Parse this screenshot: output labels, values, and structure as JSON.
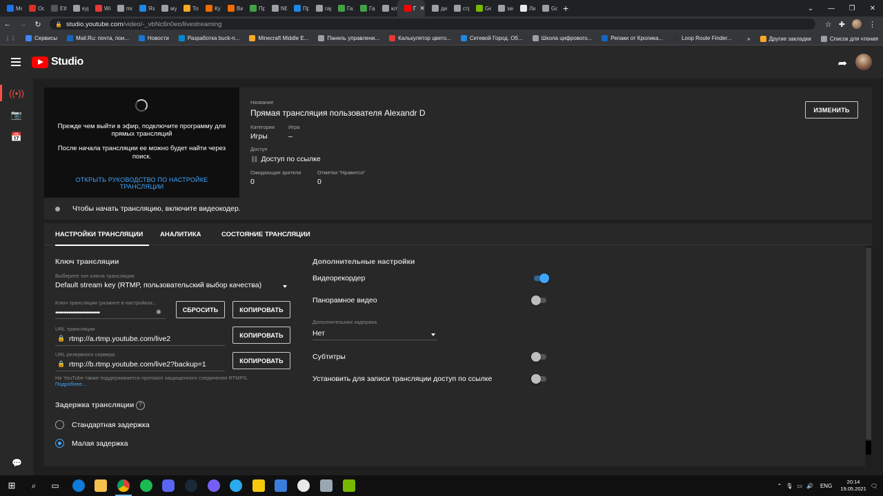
{
  "browser": {
    "tabs": [
      {
        "label": "Мес",
        "color": "#1a73e8"
      },
      {
        "label": "Офс",
        "color": "#d93025"
      },
      {
        "label": "Ethe",
        "color": "#555555"
      },
      {
        "label": "курс",
        "color": "#9aa0a6"
      },
      {
        "label": "Wio",
        "color": "#e53935"
      },
      {
        "label": "mod",
        "color": "#9aa0a6"
      },
      {
        "label": "Язык",
        "color": "#1e88e5"
      },
      {
        "label": "муст",
        "color": "#9aa0a6"
      },
      {
        "label": "Това",
        "color": "#f9a825"
      },
      {
        "label": "Купи",
        "color": "#ef6c00"
      },
      {
        "label": "Виде",
        "color": "#ef6c00"
      },
      {
        "label": "Прис",
        "color": "#43a047"
      },
      {
        "label": "NEO",
        "color": "#9aa0a6"
      },
      {
        "label": "Прос",
        "color": "#1e88e5"
      },
      {
        "label": "гара",
        "color": "#9aa0a6"
      },
      {
        "label": "Гара",
        "color": "#43a047"
      },
      {
        "label": "Гара",
        "color": "#43a047"
      },
      {
        "label": "ютуб",
        "color": "#9aa0a6"
      },
      {
        "label": "Г",
        "color": "#ff0000",
        "active": true
      },
      {
        "label": "диск",
        "color": "#9aa0a6"
      },
      {
        "label": "стри",
        "color": "#9aa0a6"
      },
      {
        "label": "Gefo",
        "color": "#76b900"
      },
      {
        "label": "забы",
        "color": "#9aa0a6"
      },
      {
        "label": "Личн",
        "color": "#e8eaed"
      },
      {
        "label": "Goo",
        "color": "#9aa0a6"
      }
    ],
    "url_host": "studio.youtube.com",
    "url_path": "/video/-_vbNc6n0eo/livestreaming",
    "bookmarks": [
      {
        "label": "Сервисы",
        "color": "#4285f4"
      },
      {
        "label": "Mail.Ru: почта, пои...",
        "color": "#1565c0"
      },
      {
        "label": "Новости",
        "color": "#1976d2"
      },
      {
        "label": "Разработка buck-n...",
        "color": "#0288d1"
      },
      {
        "label": "Minecraft Middle E...",
        "color": "#f9a825"
      },
      {
        "label": "Панель управлени...",
        "color": "#9aa0a6"
      },
      {
        "label": "Калькулятор цвето...",
        "color": "#e53935"
      },
      {
        "label": "Сетевой Город. Об...",
        "color": "#1e88e5"
      },
      {
        "label": "Школа цифрового...",
        "color": "#9aa0a6"
      },
      {
        "label": "Репаки от Кролика...",
        "color": "#1565c0"
      },
      {
        "label": "Loop Route Finder...",
        "color": "#333333"
      }
    ],
    "bookmarks_other": "Другие закладки",
    "reading_list": "Список для чтения"
  },
  "header": {
    "logo_text": "Studio"
  },
  "preview": {
    "text1": "Прежде чем выйти в эфир, подключите программу для прямых трансляций",
    "text2": "После начала трансляции ее можно будет найти через поиск.",
    "link": "ОТКРЫТЬ РУКОВОДСТВО ПО НАСТРОЙКЕ ТРАНСЛЯЦИИ",
    "status": "Чтобы начать трансляцию, включите видеокодер."
  },
  "info": {
    "title_label": "Название",
    "title": "Прямая трансляция пользователя Alexandr D",
    "category_label": "Категория",
    "category": "Игры",
    "game_label": "Игра",
    "game": "–",
    "access_label": "Доступ",
    "access": "Доступ по ссылке",
    "waiting_label": "Ожидающие зрители",
    "waiting": "0",
    "likes_label": "Отметки \"Нравится\"",
    "likes": "0",
    "edit_button": "ИЗМЕНИТЬ"
  },
  "tabs": [
    "НАСТРОЙКИ ТРАНСЛЯЦИИ",
    "АНАЛИТИКА",
    "СОСТОЯНИЕ ТРАНСЛЯЦИИ"
  ],
  "stream_key": {
    "section_title": "Ключ трансляции",
    "type_label": "Выберите тип ключа трансляции",
    "type_value": "Default stream key (RTMP, пользовательский выбор качества)",
    "key_label": "Ключ трансляции (укажите в настройках...",
    "key_value": "••••••••••••••••••••••••",
    "reset_button": "СБРОСИТЬ",
    "copy_button": "КОПИРОВАТЬ",
    "url_label": "URL трансляции",
    "url_value": "rtmp://a.rtmp.youtube.com/live2",
    "backup_label": "URL резервного сервера",
    "backup_value": "rtmp://b.rtmp.youtube.com/live2?backup=1",
    "rtmps_note": "На YouTube также поддерживается протокол защищенного соединения RTMPS.",
    "more_link": "Подробнее..."
  },
  "latency": {
    "section_title": "Задержка трансляции",
    "help": "?",
    "options": [
      {
        "label": "Стандартная задержка",
        "selected": false
      },
      {
        "label": "Малая задержка",
        "selected": true
      }
    ]
  },
  "extra": {
    "section_title": "Дополнительные настройки",
    "dvr": "Видеорекордер",
    "dvr_on": true,
    "panorama": "Панорамное видео",
    "panorama_on": false,
    "delay_label": "Дополнительная задержка",
    "delay_value": "Нет",
    "subtitles": "Субтитры",
    "subtitles_on": false,
    "unlisted": "Установить для записи трансляции доступ по ссылке",
    "unlisted_on": false
  },
  "taskbar": {
    "lang": "ENG",
    "time": "20:14",
    "date": "19.05.2021"
  },
  "colors": {
    "accent": "#3ea6ff",
    "brand_red": "#ff0000",
    "background": "#1f1f1f",
    "panel": "#282828"
  }
}
